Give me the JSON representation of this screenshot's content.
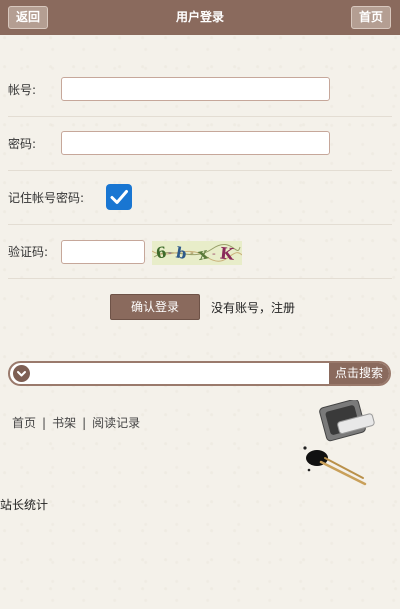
{
  "header": {
    "back_label": "返回",
    "title": "用户登录",
    "home_label": "首页"
  },
  "form": {
    "account_label": "帐号:",
    "account_value": "",
    "password_label": "密码:",
    "password_value": "",
    "remember_label": "记住帐号密码:",
    "remember_checked": true,
    "captcha_label": "验证码:",
    "captcha_value": "",
    "captcha_text": "6-b-K"
  },
  "actions": {
    "submit_label": "确认登录",
    "register_label": "没有账号，注册"
  },
  "search": {
    "button_label": "点击搜索",
    "value": ""
  },
  "footer": {
    "nav": [
      "首页",
      "书架",
      "阅读记录"
    ],
    "stats_label": "站长统计"
  },
  "colors": {
    "header_bg": "#8a6a5d",
    "page_bg": "#f4f1ea",
    "checkbox": "#1976d2"
  }
}
